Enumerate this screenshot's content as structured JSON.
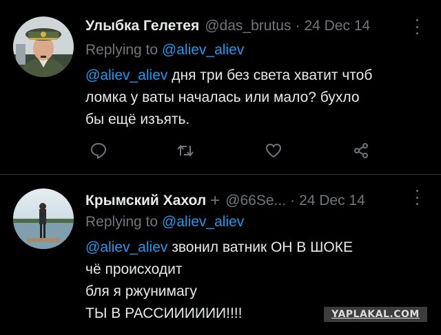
{
  "tweets": [
    {
      "name": "Улыбка Гелетея",
      "handle": "@das_brutus",
      "separator": "·",
      "date": "24 Dec 14",
      "replying_prefix": "Replying to",
      "replying_to": "@aliev_aliev",
      "mention": "@aliev_aliev",
      "lines": [
        " дня три без света хватит чтоб",
        "ломка у ваты началась или мало? бухло",
        "бы ещё изъять."
      ],
      "actions": [
        "reply-icon",
        "retweet-icon",
        "like-icon",
        "share-icon"
      ]
    },
    {
      "name": "Крымский Хахол",
      "badge": "+",
      "handle": "@66Se...",
      "separator": "·",
      "date": "24 Dec 14",
      "replying_prefix": "Replying to",
      "replying_to": "@aliev_aliev",
      "mention": "@aliev_aliev",
      "lines": [
        " звонил ватник ОН В ШОКЕ",
        "чё происходит",
        "бля я ржунимагу",
        "ТЫ В РАССИИИИИИ!!!!"
      ]
    }
  ],
  "watermark": "YAPLAKAL.COM",
  "colors": {
    "background": "#000000",
    "text": "#e7e9ea",
    "muted": "#71767b",
    "link": "#1d9bf0",
    "divider": "#2f3336"
  }
}
